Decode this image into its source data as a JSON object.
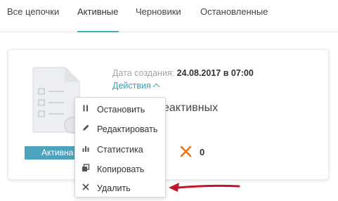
{
  "tabs": [
    {
      "label": "Все цепочки"
    },
    {
      "label": "Активные"
    },
    {
      "label": "Черновики"
    },
    {
      "label": "Остановленные"
    }
  ],
  "active_tab": "Активные",
  "card": {
    "created_label": "Дата создания:",
    "created_value": "24.08.2017 в 07:00",
    "actions_label": "Действия",
    "name_fragment": "еактивных",
    "status_badge": "Активна",
    "error_count": "0"
  },
  "menu": {
    "items": [
      {
        "label": "Остановить",
        "icon": "pause-icon"
      },
      {
        "label": "Редактировать",
        "icon": "pencil-icon"
      },
      {
        "label": "Статистика",
        "icon": "bar-chart-icon"
      },
      {
        "label": "Копировать",
        "icon": "copy-icon"
      },
      {
        "label": "Удалить",
        "icon": "close-icon"
      }
    ]
  },
  "colors": {
    "accent": "#3cb0c2",
    "badge": "#4ba3bd",
    "error": "#e8751a",
    "arrow": "#c0172c"
  }
}
